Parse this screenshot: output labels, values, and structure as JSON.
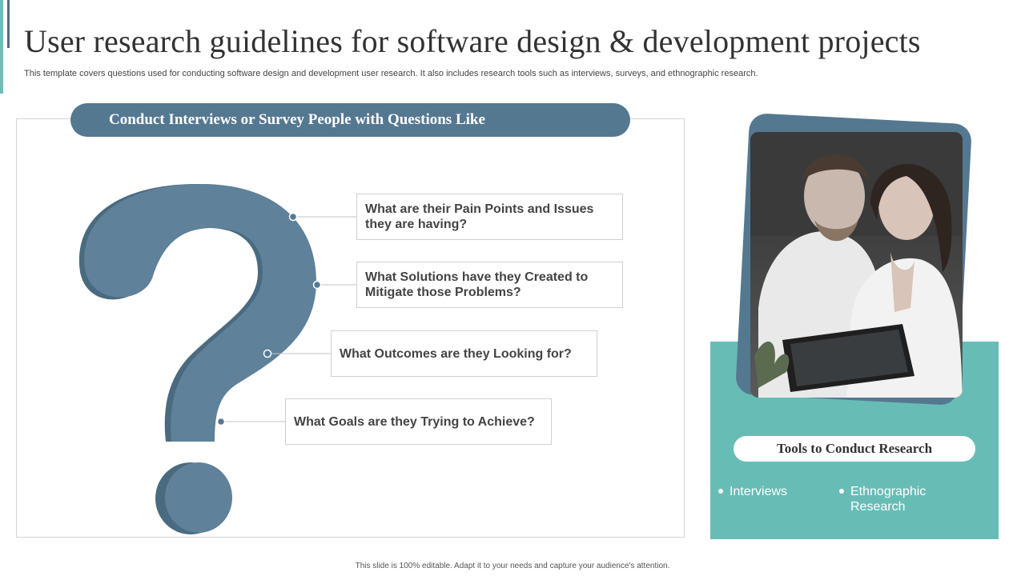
{
  "title": "User research guidelines for software design & development projects",
  "subtitle": "This template covers questions used for conducting software design and development user research. It also includes research tools such as interviews, surveys, and ethnographic research.",
  "left_section": {
    "header": "Conduct Interviews or Survey People with Questions Like",
    "questions": [
      "What are their Pain Points and Issues they are having?",
      "What Solutions have they Created to Mitigate those Problems?",
      "What Outcomes are they Looking for?",
      "What Goals are they Trying to Achieve?"
    ]
  },
  "right_section": {
    "header": "Tools to Conduct Research",
    "tools": [
      "Interviews",
      "Ethnographic Research"
    ]
  },
  "footer": "This slide is 100% editable. Adapt it to your needs and capture your audience's attention.",
  "colors": {
    "primary_blue": "#557891",
    "teal": "#67bdb6",
    "text_dark": "#333333"
  },
  "icons": [
    "question-mark-icon",
    "bullet-dot-icon"
  ]
}
